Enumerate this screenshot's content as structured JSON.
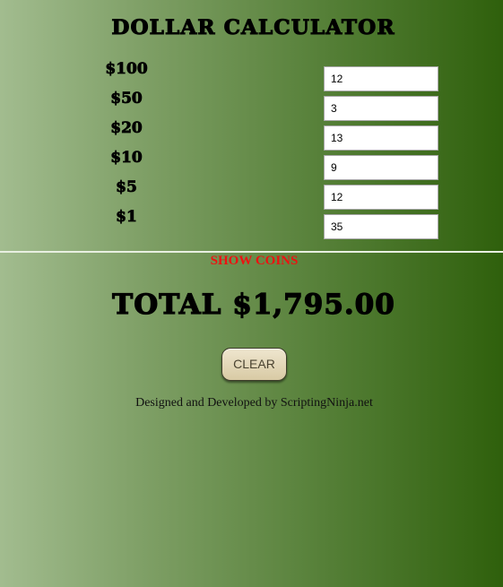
{
  "app": {
    "title": "Dollar Calculator"
  },
  "denominations": [
    {
      "label": "$100",
      "value": "12"
    },
    {
      "label": "$50",
      "value": "3"
    },
    {
      "label": "$20",
      "value": "13"
    },
    {
      "label": "$10",
      "value": "9"
    },
    {
      "label": "$5",
      "value": "12"
    },
    {
      "label": "$1",
      "value": "35"
    }
  ],
  "show_coins_label": "SHOW COINS",
  "total": {
    "text": "Total $1,795.00"
  },
  "clear_label": "CLEAR",
  "footer": {
    "text": "Designed and Developed by ScriptingNinja.net"
  },
  "colors": {
    "show_coins": "#ee1111",
    "background_left": "#a2bc8f",
    "background_right": "#2f600c"
  }
}
